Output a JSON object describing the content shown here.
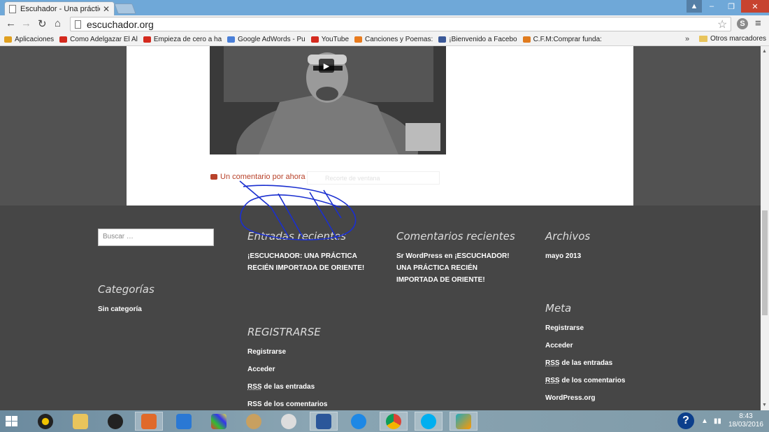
{
  "browser": {
    "tab_title": "Escuhador - Una práctica",
    "tab_close": "✕",
    "url": "escuchador.org",
    "bookmarks": [
      {
        "label": "Aplicaciones",
        "color": "#e0a020"
      },
      {
        "label": "Como Adelgazar El Al",
        "color": "#d42a1e"
      },
      {
        "label": "Empieza de cero a ha",
        "color": "#d42a1e"
      },
      {
        "label": "Google AdWords - Pu",
        "color": "#4a7fd8"
      },
      {
        "label": "YouTube",
        "color": "#d42a1e"
      },
      {
        "label": "Canciones y Poemas:",
        "color": "#e87b1e"
      },
      {
        "label": "¡Bienvenido a Facebo",
        "color": "#3b5998"
      },
      {
        "label": "C.F.M:Comprar funda:",
        "color": "#e07b1e"
      }
    ],
    "bookmarks_more": "»",
    "other_bookmarks": "Otros marcadores"
  },
  "post": {
    "comment_link": "Un comentario por ahora",
    "faded_text": "Recorte de ventana"
  },
  "footer": {
    "search_placeholder": "Buscar …",
    "recent_posts_title": "Entradas recientes",
    "recent_posts_link_line1": "¡ESCUCHADOR: UNA PRÁCTICA",
    "recent_posts_link_line2": "RECIÉN IMPORTADA DE ORIENTE!",
    "recent_comments_title": "Comentarios recientes",
    "recent_comment_author": "Sr WordPress",
    "recent_comment_en": "en",
    "recent_comment_line1_post": "¡ESCUCHADOR!",
    "recent_comment_line2": "UNA PRÁCTICA RECIÉN",
    "recent_comment_line3": "IMPORTADA DE ORIENTE!",
    "archives_title": "Archivos",
    "archive_item": "mayo 2013",
    "categories_title": "Categorías",
    "category_item": "Sin categoría",
    "register_title": "REGISTRARSE",
    "register_links": {
      "register": "Registrarse",
      "login": "Acceder",
      "rss_abbr": "RSS",
      "rss_entries_rest": "de las entradas",
      "rss_comments_rest": "de los comentarios"
    },
    "meta_title": "Meta",
    "meta_links": {
      "register": "Registrarse",
      "login": "Acceder",
      "rss_abbr": "RSS",
      "rss_entries_rest": "de las entradas",
      "rss_comments_rest": "de los comentarios",
      "wordpress": "WordPress.org"
    }
  },
  "taskbar": {
    "time": "8:43",
    "date": "18/03/2016"
  }
}
